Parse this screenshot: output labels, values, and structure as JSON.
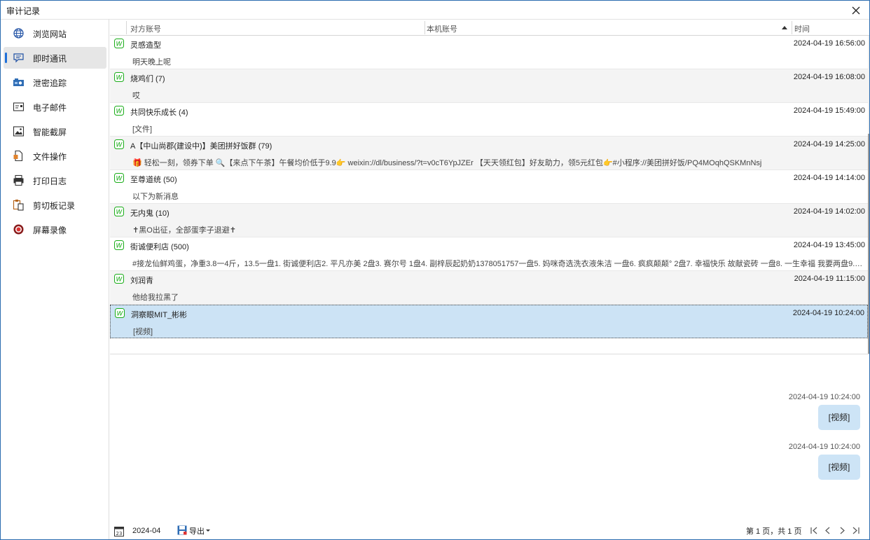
{
  "window": {
    "title": "审计记录"
  },
  "sidebar": {
    "items": [
      {
        "label": "浏览网站",
        "icon": "globe-icon",
        "active": false
      },
      {
        "label": "即时通讯",
        "icon": "chat-icon",
        "active": true
      },
      {
        "label": "泄密追踪",
        "icon": "tracking-icon",
        "active": false
      },
      {
        "label": "电子邮件",
        "icon": "mail-icon",
        "active": false
      },
      {
        "label": "智能截屏",
        "icon": "screenshot-icon",
        "active": false
      },
      {
        "label": "文件操作",
        "icon": "file-icon",
        "active": false
      },
      {
        "label": "打印日志",
        "icon": "printer-icon",
        "active": false
      },
      {
        "label": "剪切板记录",
        "icon": "clipboard-icon",
        "active": false
      },
      {
        "label": "屏幕录像",
        "icon": "record-icon",
        "active": false
      }
    ]
  },
  "grid": {
    "columns": [
      "对方账号",
      "本机账号",
      "时间"
    ],
    "rows": [
      {
        "name": "灵感造型",
        "time": "2024-04-19 16:56:00",
        "message": "明天晚上呢"
      },
      {
        "name": "烧鸡们 (7)",
        "time": "2024-04-19 16:08:00",
        "message": "哎"
      },
      {
        "name": "共同快乐成长 (4)",
        "time": "2024-04-19 15:49:00",
        "message": "[文件]"
      },
      {
        "name": "A【中山尚郡(建设中)】美团拼好饭群 (79)",
        "time": "2024-04-19 14:25:00",
        "message": "🎁 轻松一刻，领券下单 🔍【来点下午茶】午餐均价低于9.9👉 weixin://dl/business/?t=v0cT6YpJZEr 【天天领红包】好友助力，领5元红包👉#小程序://美团拼好饭/PQ4MOqhQSKMnNsj"
      },
      {
        "name": "至尊道统 (50)",
        "time": "2024-04-19 14:14:00",
        "message": "以下为新消息"
      },
      {
        "name": "无内鬼 (10)",
        "time": "2024-04-19 14:02:00",
        "message": "✝黑O出征，全部蛋李子退避✝"
      },
      {
        "name": "街诚便利店 (500)",
        "time": "2024-04-19 13:45:00",
        "message": "#接龙仙鲜鸡蛋，净重3.8一4斤，13.5一盘1. 街诚便利店2. 平凡亦美 2盘3. 赛尔号 1盘4. 副梓辰起奶奶1378051757一盘5. 妈咪奇选洗衣液朱洁 一盘6. 疯疯颠颠° 2盘7. 幸福快乐 故献瓷砖 一盘8. 一生幸福 我要两盘9. 飞奔的蜗牛 ..."
      },
      {
        "name": "刘润青",
        "time": "2024-04-19 11:15:00",
        "message": "他给我拉黑了"
      },
      {
        "name": "洞察眼MIT_彬彬",
        "time": "2024-04-19 10:24:00",
        "message": "[视频]",
        "selected": true
      }
    ]
  },
  "chat": {
    "messages": [
      {
        "time": "2024-04-19 10:24:00",
        "text": "[视频]"
      },
      {
        "time": "2024-04-19 10:24:00",
        "text": "[视频]"
      }
    ]
  },
  "footer": {
    "date": "2024-04",
    "export_label": "导出",
    "page_info": "第 1 页，共 1 页"
  },
  "colors": {
    "accent": "#1e6fd9",
    "selected_row": "#cce3f5",
    "bubble": "#cde4f6",
    "wechat_green": "#1aad19"
  }
}
